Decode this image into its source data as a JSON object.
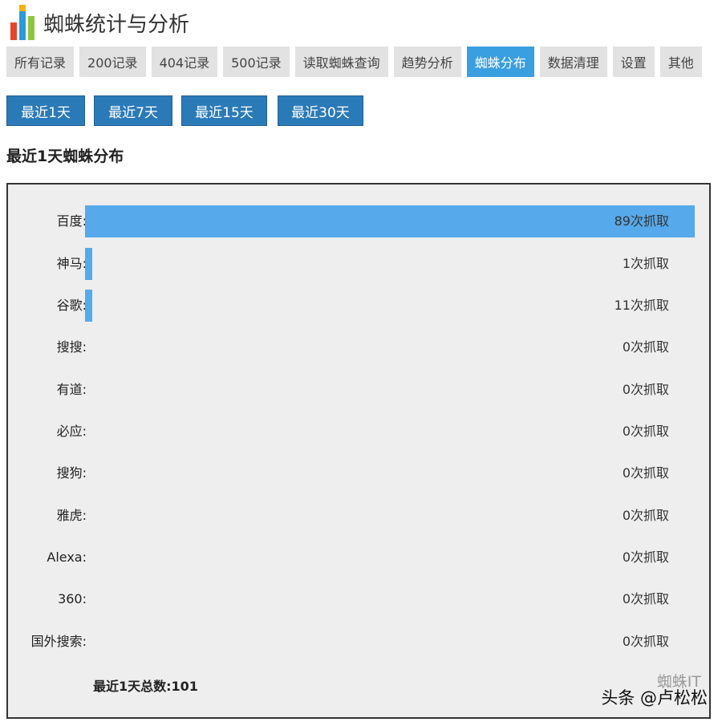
{
  "app": {
    "title": "蜘蛛统计与分析"
  },
  "nav": {
    "tabs": [
      {
        "label": "所有记录",
        "active": false
      },
      {
        "label": "200记录",
        "active": false
      },
      {
        "label": "404记录",
        "active": false
      },
      {
        "label": "500记录",
        "active": false
      },
      {
        "label": "读取蜘蛛查询",
        "active": false
      },
      {
        "label": "趋势分析",
        "active": false
      },
      {
        "label": "蜘蛛分布",
        "active": true
      },
      {
        "label": "数据清理",
        "active": false
      },
      {
        "label": "设置",
        "active": false
      },
      {
        "label": "其他",
        "active": false
      }
    ]
  },
  "ranges": [
    "最近1天",
    "最近7天",
    "最近15天",
    "最近30天"
  ],
  "section": {
    "title": "最近1天蜘蛛分布"
  },
  "distribution": {
    "max": 89,
    "rows": [
      {
        "label": "百度:",
        "count": 89,
        "text": "89次抓取"
      },
      {
        "label": "神马:",
        "count": 1,
        "text": "1次抓取"
      },
      {
        "label": "谷歌:",
        "count": 1,
        "text": "11次抓取"
      },
      {
        "label": "搜搜:",
        "count": 0,
        "text": "0次抓取"
      },
      {
        "label": "有道:",
        "count": 0,
        "text": "0次抓取"
      },
      {
        "label": "必应:",
        "count": 0,
        "text": "0次抓取"
      },
      {
        "label": "搜狗:",
        "count": 0,
        "text": "0次抓取"
      },
      {
        "label": "雅虎:",
        "count": 0,
        "text": "0次抓取"
      },
      {
        "label": "Alexa:",
        "count": 0,
        "text": "0次抓取"
      },
      {
        "label": "360:",
        "count": 0,
        "text": "0次抓取"
      },
      {
        "label": "国外搜索:",
        "count": 0,
        "text": "0次抓取"
      }
    ],
    "total": "最近1天总数:101"
  },
  "watermark": {
    "faded": "蜘蛛IT",
    "text": "头条 @卢松松"
  },
  "colors": {
    "active_tab": "#3a9fe0",
    "range_button": "#2b7ab8",
    "bar": "#56a9ea"
  }
}
